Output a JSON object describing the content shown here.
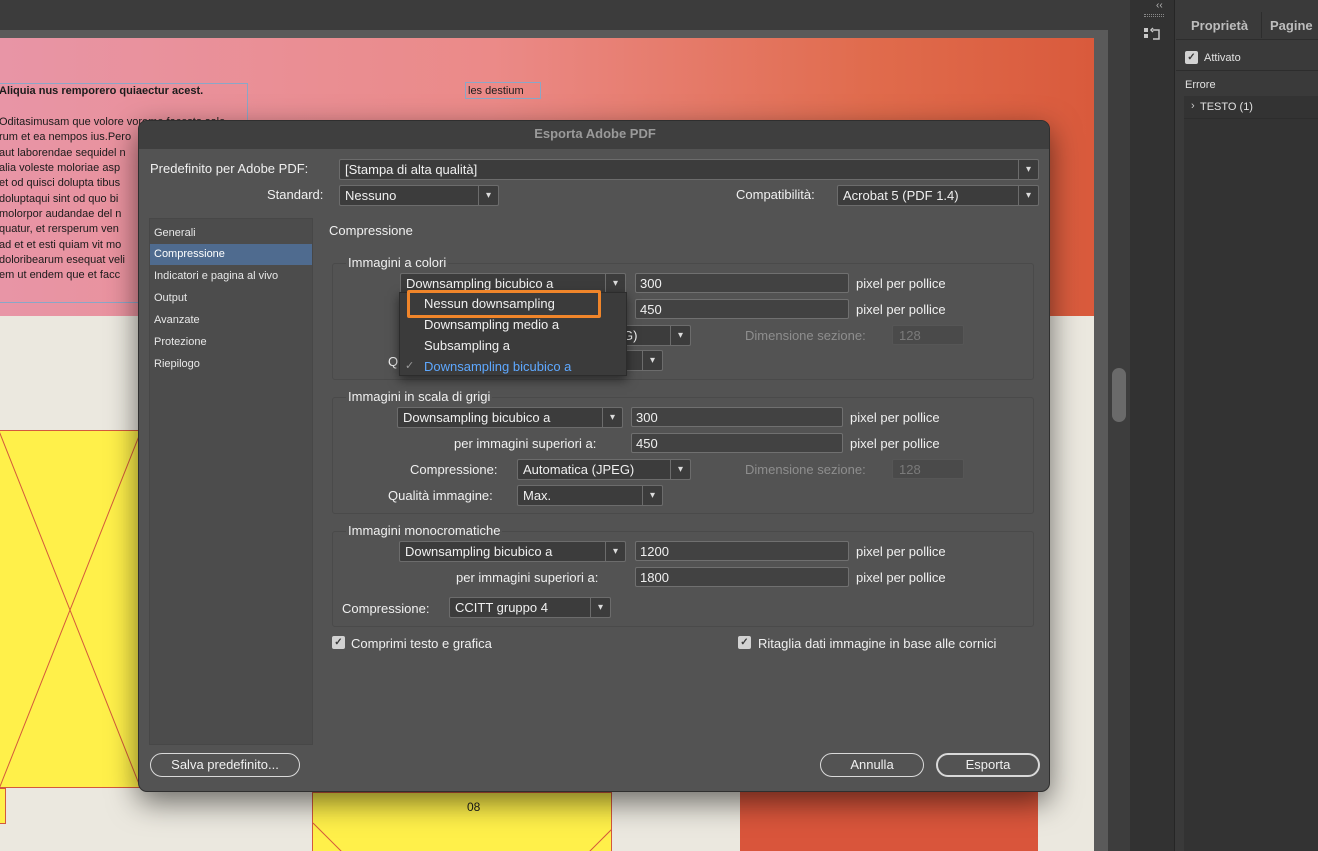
{
  "document": {
    "heading_text": "Aliquia nus remporero quiaectur acest.",
    "body_lines": [
      "Oditasimusam que volore voreme facesto sole",
      "rum et ea nempos ius.Pero",
      "aut laborendae sequidel n",
      "alia voleste moloriae asp",
      "et od quisci dolupta tibus",
      "doluptaqui sint od quo bi",
      "molorpor audandae del n",
      "quatur, et rersperum ven",
      "ad et et esti quiam vit mo",
      "doloribearum esequat veli",
      "em ut endem que et facc"
    ],
    "small_frame_text": "les destium",
    "page_number": "08"
  },
  "right_panel": {
    "tabs": [
      "Proprietà",
      "Pagine"
    ],
    "activated_label": "Attivato",
    "activated_checked": true,
    "errors_label": "Errore",
    "tree_item": "TESTO (1)"
  },
  "dialog": {
    "title": "Esporta Adobe PDF",
    "preset_label": "Predefinito per Adobe PDF:",
    "preset_value": "[Stampa di alta qualità]",
    "standard_label": "Standard:",
    "standard_value": "Nessuno",
    "compat_label": "Compatibilità:",
    "compat_value": "Acrobat 5 (PDF 1.4)",
    "sidebar": [
      "Generali",
      "Compressione",
      "Indicatori e pagina al vivo",
      "Output",
      "Avanzate",
      "Protezione",
      "Riepilogo"
    ],
    "selected_section": "Compressione",
    "section_title": "Compressione",
    "color_images": {
      "title": "Immagini a colori",
      "sampling": "Downsampling bicubico a",
      "ppi": "300",
      "ppi_unit": "pixel per pollice",
      "above": "450",
      "above_unit": "pixel per pollice",
      "compression_partial": "G)",
      "tile_label": "Dimensione sezione:",
      "tile_value": "128",
      "quality_partial": "Q"
    },
    "gray_images": {
      "title": "Immagini in scala di grigi",
      "sampling": "Downsampling bicubico a",
      "ppi": "300",
      "ppi_unit": "pixel per pollice",
      "above_label": "per immagini superiori a:",
      "above": "450",
      "above_unit": "pixel per pollice",
      "compression_label": "Compressione:",
      "compression_value": "Automatica (JPEG)",
      "tile_label": "Dimensione sezione:",
      "tile_value": "128",
      "quality_label": "Qualità immagine:",
      "quality_value": "Max."
    },
    "mono_images": {
      "title": "Immagini monocromatiche",
      "sampling": "Downsampling bicubico a",
      "ppi": "1200",
      "ppi_unit": "pixel per pollice",
      "above_label": "per immagini superiori a:",
      "above": "1800",
      "above_unit": "pixel per pollice",
      "compression_label": "Compressione:",
      "compression_value": "CCITT gruppo 4"
    },
    "compress_text_label": "Comprimi testo e grafica",
    "compress_text_checked": true,
    "crop_label": "Ritaglia dati immagine in base alle cornici",
    "crop_checked": true,
    "save_preset_button": "Salva predefinito...",
    "cancel_button": "Annulla",
    "export_button": "Esporta",
    "sampling_menu": {
      "options": [
        "Nessun downsampling",
        "Downsampling medio a",
        "Subsampling a",
        "Downsampling bicubico a"
      ],
      "selected": "Downsampling bicubico a",
      "highlighted": "Nessun downsampling",
      "highlight_color": "#f0852a",
      "selected_color": "#5ea8ff"
    }
  }
}
